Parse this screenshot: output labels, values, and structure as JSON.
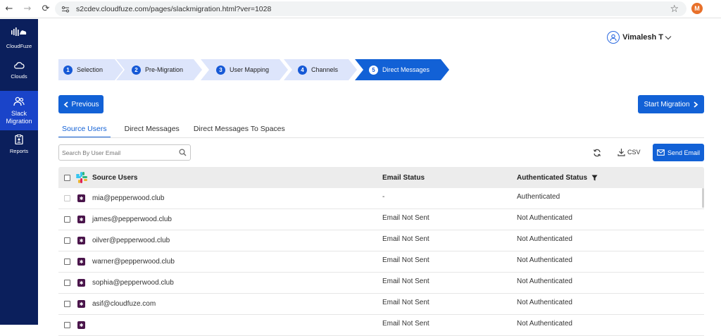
{
  "browser": {
    "url": "s2cdev.cloudfuze.com/pages/slackmigration.html?ver=1028",
    "profile_initial": "M"
  },
  "sidebar": {
    "brand": "CloudFuze",
    "items": [
      {
        "label": "Clouds",
        "icon": "cloud-icon"
      },
      {
        "label": "Slack Migration",
        "icon": "users-icon",
        "active": true
      },
      {
        "label": "Reports",
        "icon": "report-icon"
      }
    ]
  },
  "header": {
    "user_name": "Vimalesh T"
  },
  "stepper": {
    "steps": [
      {
        "num": "1",
        "label": "Selection"
      },
      {
        "num": "2",
        "label": "Pre-Migration"
      },
      {
        "num": "3",
        "label": "User Mapping"
      },
      {
        "num": "4",
        "label": "Channels"
      },
      {
        "num": "5",
        "label": "Direct Messages",
        "active": true
      }
    ]
  },
  "actions": {
    "previous_label": "Previous",
    "start_label": "Start Migration"
  },
  "tabs": [
    {
      "label": "Source Users",
      "active": true
    },
    {
      "label": "Direct Messages"
    },
    {
      "label": "Direct Messages To Spaces"
    }
  ],
  "toolbar": {
    "search_placeholder": "Search By User Email",
    "csv_label": "CSV",
    "send_email_label": "Send Email"
  },
  "table": {
    "columns": [
      "Source Users",
      "Email Status",
      "Authenticated Status"
    ],
    "rows": [
      {
        "email": "mia@pepperwood.club",
        "email_status": "-",
        "auth_status": "Authenticated",
        "disabled": true
      },
      {
        "email": "james@pepperwood.club",
        "email_status": "Email Not Sent",
        "auth_status": "Not Authenticated"
      },
      {
        "email": "oilver@pepperwood.club",
        "email_status": "Email Not Sent",
        "auth_status": "Not Authenticated"
      },
      {
        "email": "warner@pepperwood.club",
        "email_status": "Email Not Sent",
        "auth_status": "Not Authenticated"
      },
      {
        "email": "sophia@pepperwood.club",
        "email_status": "Email Not Sent",
        "auth_status": "Not Authenticated"
      },
      {
        "email": "asif@cloudfuze.com",
        "email_status": "Email Not Sent",
        "auth_status": "Not Authenticated"
      },
      {
        "email": "",
        "email_status": "Email Not Sent",
        "auth_status": "Not Authenticated"
      }
    ]
  },
  "colors": {
    "sidebar": "#0b1f5c",
    "sidebar_active": "#1a44c9",
    "primary": "#1261d6",
    "step_inactive": "#dde5fb"
  }
}
